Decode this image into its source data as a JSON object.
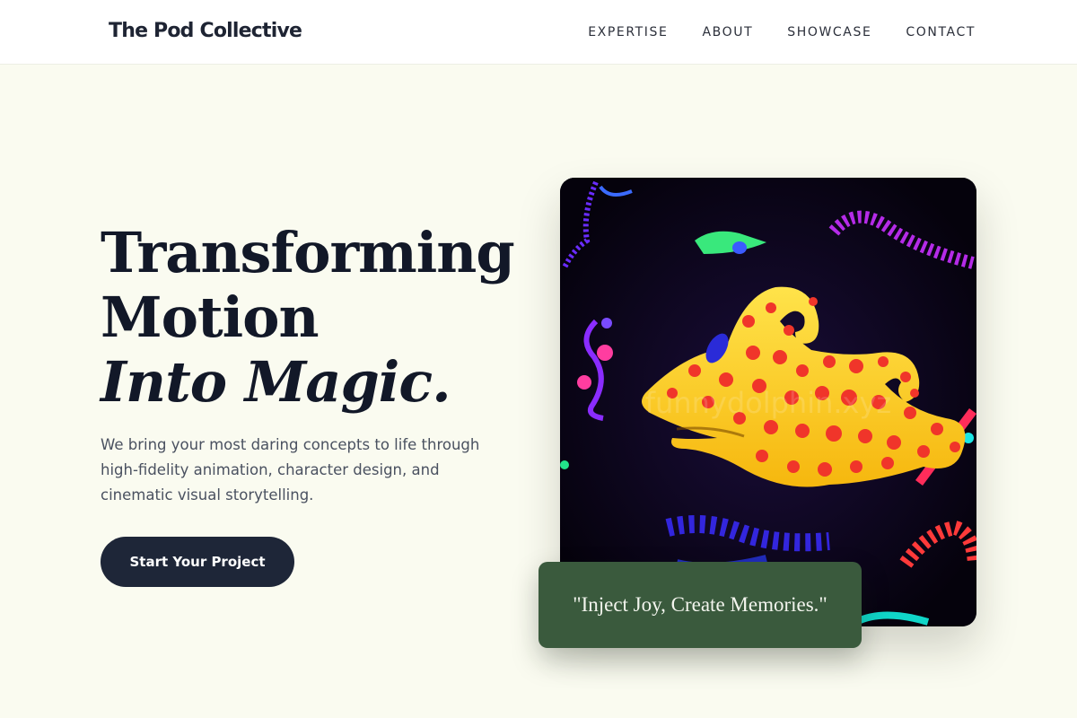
{
  "header": {
    "logo": "The Pod Collective",
    "nav": [
      "EXPERTISE",
      "ABOUT",
      "SHOWCASE",
      "CONTACT"
    ]
  },
  "hero": {
    "headline_line1": "Transforming",
    "headline_line2": "Motion",
    "headline_line3": "Into Magic.",
    "description": "We bring your most daring concepts to life through high-fidelity animation, character design, and cinematic visual storytelling.",
    "cta_label": "Start Your Project"
  },
  "artwork": {
    "watermark": "funnydolphin.xyz",
    "quote": "\"Inject Joy, Create Memories.\""
  },
  "colors": {
    "background": "#fafbf0",
    "cta": "#1e2638",
    "quote_card": "#3a5a3d",
    "creature": "#ffd21f",
    "spots": "#f0352a"
  }
}
